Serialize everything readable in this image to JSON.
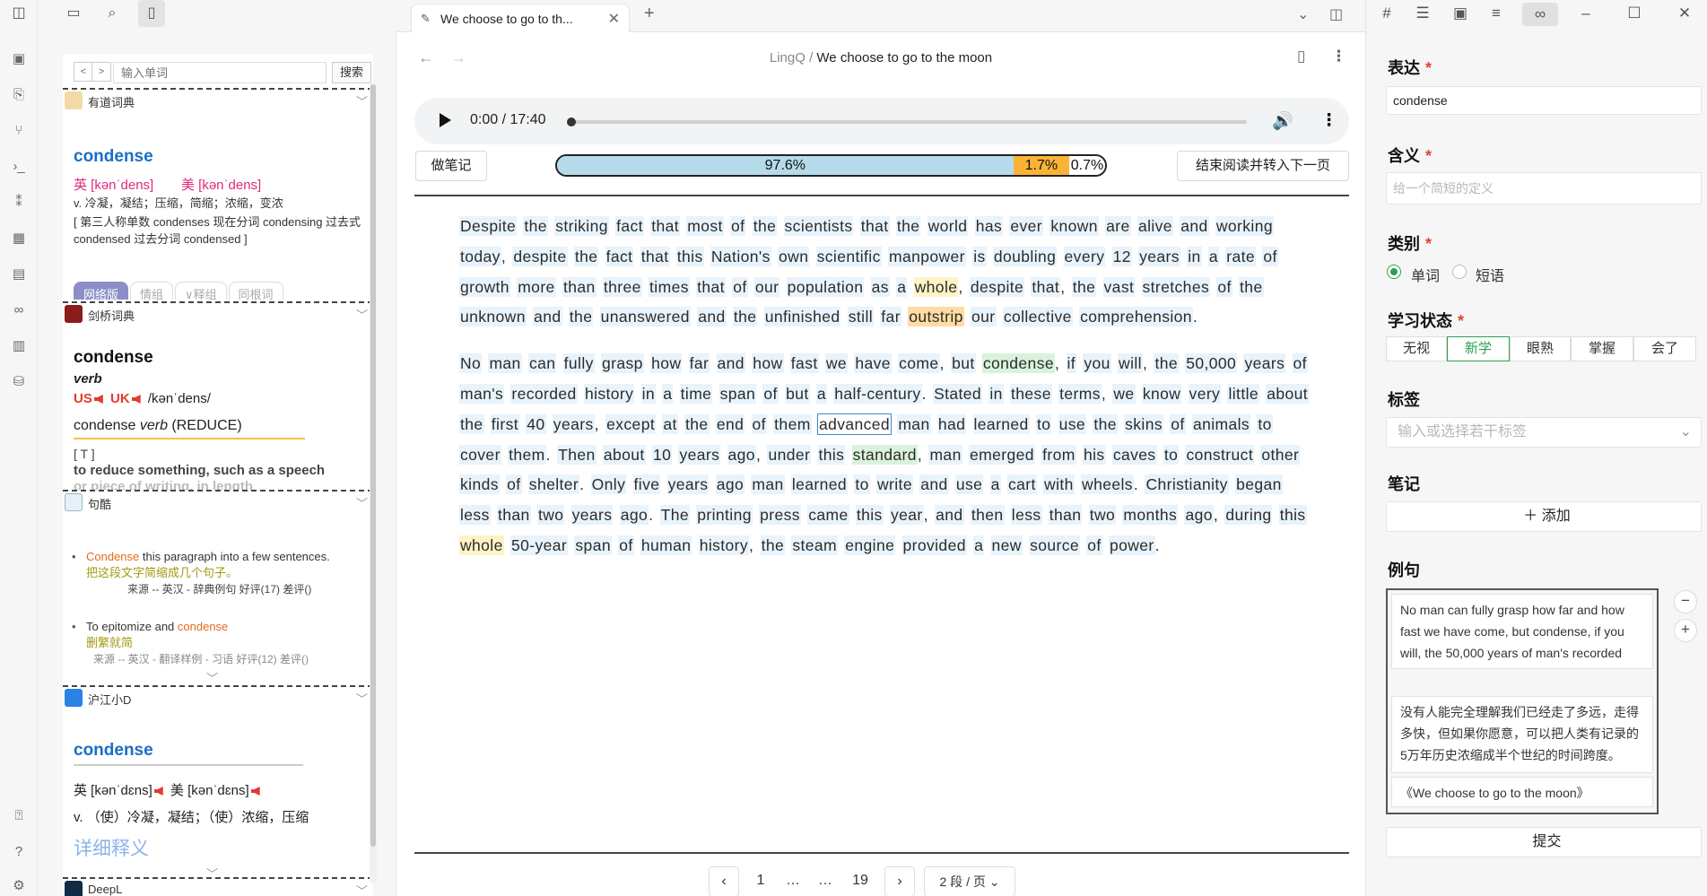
{
  "ribbon": {
    "icons": [
      "sidebar-left-icon",
      "cards-icon",
      "file-copy-icon",
      "graph-icon",
      "terminal-icon",
      "numbers-icon",
      "blocks-icon",
      "book-icon",
      "glasses-icon",
      "chart-icon",
      "database-icon",
      "help-bottom-icon",
      "help-icon",
      "settings-icon"
    ]
  },
  "dictionary": {
    "input_placeholder": "输入单词",
    "search_label": "搜索",
    "prev": "<",
    "next": ">",
    "youdao": {
      "name": "有道词典",
      "headword": "condense",
      "uk": "英 [kənˈdens]",
      "us": "美 [kənˈdens]",
      "definition": "v. 冷凝，凝结；压缩，简缩；浓缩，变浓",
      "forms": "[ 第三人称单数 condenses 现在分词 condensing 过去式 condensed 过去分词 condensed ]",
      "tabs": [
        "网络版",
        "情组",
        "∨释组",
        "同根词"
      ]
    },
    "cambridge": {
      "name": "剑桥词典",
      "headword": "condense",
      "pos": "verb",
      "us": "US",
      "uk": "UK",
      "pron": "/kənˈdens/",
      "sense_title": "condense verb (REDUCE)",
      "sense_word": "condense",
      "sense_pos": "verb",
      "sense_gw": "(REDUCE)",
      "gram": "[ T ]",
      "definition": "to reduce something, such as a speech",
      "definition2": "or piece of writing, in length"
    },
    "jukuu": {
      "name": "句酷",
      "items": [
        {
          "en_hl": "Condense",
          "en_rest": " this paragraph into a few sentences.",
          "zh": "把这段文字简缩成几个句子。",
          "src": "来源 -- 英汉 - 辞典例句 好评(17) 差评()"
        },
        {
          "en_pre": "To epitomize and ",
          "en_hl": "condense",
          "zh": "删繁就简",
          "src": "来源 -- 英汉 - 翻译样例 - 习语 好评(12) 差评()"
        }
      ]
    },
    "hujiang": {
      "name": "沪江小D",
      "headword": "condense",
      "uk": "英 [kənˈdɛns]",
      "us": "美 [kənˈdɛns]",
      "definition": "v. （使）冷凝，凝结；（使）浓缩，压缩",
      "detail": "详细释义"
    },
    "deepl": {
      "name": "DeepL"
    }
  },
  "tab": {
    "label": "We choose to go to th...",
    "close": "✕",
    "new": "+"
  },
  "breadcrumb": {
    "root": "LingQ",
    "sep": "/",
    "title": "We choose to go to the moon"
  },
  "audio": {
    "time": "0:00 / 17:40",
    "progress": 0.0
  },
  "toolbar": {
    "note_label": "做笔记",
    "finish_label": "结束阅读并转入下一页"
  },
  "reading_progress": {
    "known": "97.6%",
    "learning": "1.7%",
    "new": "0.7%",
    "known_value": 97.6,
    "learning_value": 1.7,
    "new_value": 0.7,
    "known_color": "#b5dbea",
    "learning_color": "#fbb335"
  },
  "reading": {
    "p1": "Despite the striking fact that most of the scientists that the world has ever known are alive and working today, despite the fact that this Nation's own scientific manpower is doubling every 12 years in a rate of growth more than three times that of our population as a whole, despite that, the vast stretches of the unknown and the unanswered and the unfinished still far outstrip our collective comprehension.",
    "p2": "No man can fully grasp how far and how fast we have come, but condense, if you will, the 50,000 years of man's recorded history in a time span of but a half-century. Stated in these terms, we know very little about the first 40 years, except at the end of them advanced man had learned to use the skins of animals to cover them. Then about 10 years ago, under this standard, man emerged from his caves to construct other kinds of shelter. Only five years ago man learned to write and use a cart with wheels. Christianity began less than two years ago. The printing press came this year, and then less than two months ago, during this whole 50-year span of human history, the steam engine provided a new source of power."
  },
  "pager": {
    "prev": "‹",
    "p1": "1",
    "e1": "…",
    "e2": "…",
    "last": "19",
    "next": "›",
    "per_page": "2 段 / 页"
  },
  "panel": {
    "expression_label": "表达",
    "expression_value": "condense",
    "meaning_label": "含义",
    "meaning_placeholder": "给一个简短的定义",
    "category_label": "类别",
    "cat_word": "单词",
    "cat_phrase": "短语",
    "status_label": "学习状态",
    "statuses": [
      "无视",
      "新学",
      "眼熟",
      "掌握",
      "会了"
    ],
    "tags_label": "标签",
    "tags_placeholder": "输入或选择若干标签",
    "notes_label": "笔记",
    "add_label": "＋ 添加",
    "examples_label": "例句",
    "example_en": "No man can fully grasp how far and how fast we have come, but condense, if you will, the 50,000 years of man's recorded",
    "example_zh": "没有人能完全理解我们已经走了多远，走得多快，但如果你愿意，可以把人类有记录的5万年历史浓缩成半个世纪的时间跨度。",
    "example_src": "《We choose to go to the moon》",
    "submit_label": "提交",
    "required": "*"
  },
  "colors": {
    "accent_green": "#2aa24a",
    "link_blue": "#1a6fc4",
    "required_red": "#e0452f"
  }
}
